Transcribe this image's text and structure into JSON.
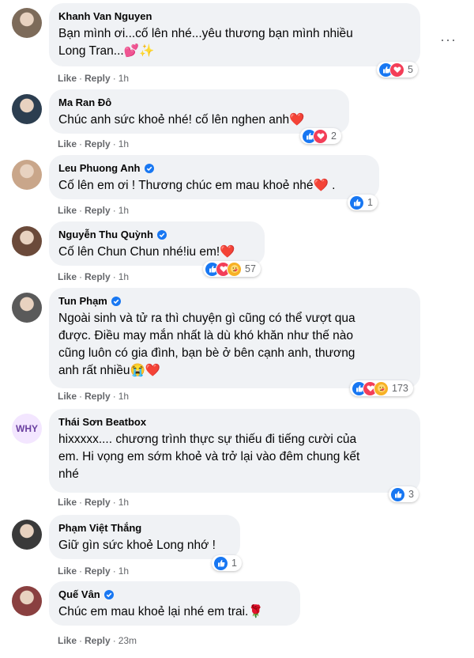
{
  "actions": {
    "like": "Like",
    "reply": "Reply",
    "separator": "·"
  },
  "more_label": "···",
  "comments": [
    {
      "author": "Khanh Van Nguyen",
      "verified": false,
      "text_lines": [
        "Bạn mình ơi...cố lên nhé...yêu thương bạn mình nhiều",
        "Long Tran..."
      ],
      "emoji": "💕✨",
      "time": "1h",
      "reactions": [
        "like",
        "love"
      ],
      "count": "5",
      "avatar_color": "#7d6b5a"
    },
    {
      "author": "Ma Ran Đô",
      "verified": false,
      "text_lines": [
        "Chúc anh sức khoẻ nhé! cố lên nghen anh"
      ],
      "emoji": "❤️",
      "time": "1h",
      "reactions": [
        "like",
        "love"
      ],
      "count": "2",
      "avatar_color": "#2c3e50"
    },
    {
      "author": "Leu Phuong Anh",
      "verified": true,
      "text_lines": [
        "Cố lên em ơi ! Thương chúc em mau khoẻ nhé"
      ],
      "emoji": "❤️",
      "suffix": " .",
      "time": "1h",
      "reactions": [
        "like"
      ],
      "count": "1",
      "avatar_color": "#c9a68a"
    },
    {
      "author": "Nguyễn Thu Quỳnh",
      "verified": true,
      "text_lines": [
        "Cố lên Chun Chun nhé!iu em!"
      ],
      "emoji": "❤️",
      "time": "1h",
      "reactions": [
        "like",
        "love",
        "care"
      ],
      "count": "57",
      "avatar_color": "#6b4a3a"
    },
    {
      "author": "Tun Phạm",
      "verified": true,
      "text_lines": [
        "Ngoài sinh và tử ra thì chuyện gì cũng có thể vượt qua",
        "được. Điều may mắn nhất là dù khó khăn như thế nào",
        "cũng luôn có gia đình, bạn bè ở bên cạnh anh, thương",
        "anh rất nhiều"
      ],
      "emoji": "😭❤️",
      "time": "1h",
      "reactions": [
        "like",
        "love",
        "care"
      ],
      "count": "173",
      "avatar_color": "#5a5a5a"
    },
    {
      "author": "Thái Sơn Beatbox",
      "verified": false,
      "avatar_text": "WHY",
      "text_lines": [
        "hixxxxx.... chương trình thực sự thiếu đi tiếng cười của",
        "em. Hi vọng em sớm khoẻ và trở lại vào đêm chung kết",
        "nhé"
      ],
      "emoji": "",
      "time": "1h",
      "reactions": [
        "like"
      ],
      "count": "3",
      "avatar_color": "#6a3fa0"
    },
    {
      "author": "Phạm Việt Thắng",
      "verified": false,
      "text_lines": [
        "Giữ gìn sức khoẻ Long nhớ !"
      ],
      "emoji": "",
      "time": "1h",
      "reactions": [
        "like"
      ],
      "count": "1",
      "avatar_color": "#3a3a3a"
    },
    {
      "author": "Quế Vân",
      "verified": true,
      "text_lines": [
        "Chúc em mau khoẻ lại nhé em trai."
      ],
      "emoji": "🌹",
      "time": "23m",
      "reactions": [],
      "count": "",
      "avatar_color": "#8a4040"
    }
  ]
}
